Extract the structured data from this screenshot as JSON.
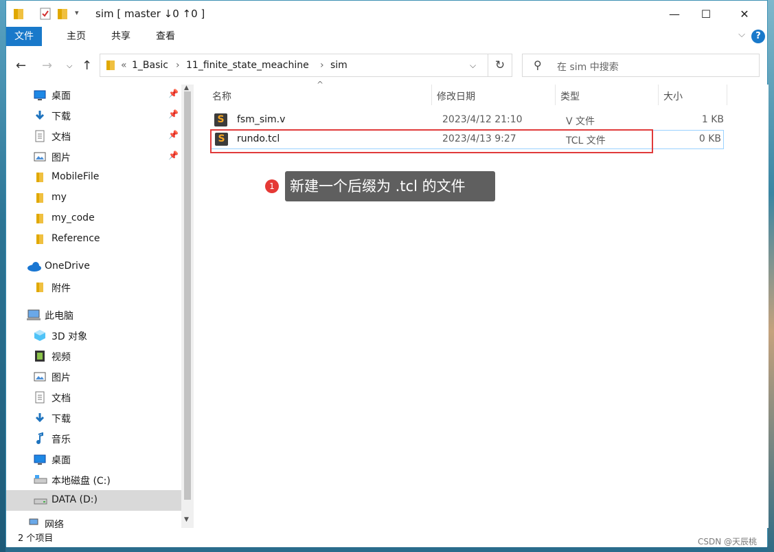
{
  "window": {
    "title": "sim [ master ↓0 ↑0 ]",
    "minimize": "—",
    "maximize": "☐",
    "close": "✕"
  },
  "ribbon": {
    "tabs": [
      "文件",
      "主页",
      "共享",
      "查看"
    ],
    "help": "?"
  },
  "address": {
    "overflow": "«",
    "parts": [
      "1_Basic",
      "11_finite_state_meachine",
      "sim"
    ],
    "separator": "›"
  },
  "search": {
    "placeholder": "在 sim 中搜索"
  },
  "sidebar": {
    "items": [
      {
        "label": "桌面",
        "icon": "desktop-icon",
        "pinned": true
      },
      {
        "label": "下载",
        "icon": "download-icon",
        "pinned": true
      },
      {
        "label": "文档",
        "icon": "document-icon",
        "pinned": true
      },
      {
        "label": "图片",
        "icon": "picture-icon",
        "pinned": true
      },
      {
        "label": "MobileFile",
        "icon": "folder-icon"
      },
      {
        "label": "my",
        "icon": "folder-icon"
      },
      {
        "label": "my_code",
        "icon": "folder-icon"
      },
      {
        "label": "Reference",
        "icon": "folder-icon"
      },
      {
        "label": "OneDrive",
        "icon": "cloud-icon"
      },
      {
        "label": "附件",
        "icon": "folder-icon"
      },
      {
        "label": "此电脑",
        "icon": "computer-icon"
      },
      {
        "label": "3D 对象",
        "icon": "cube-icon"
      },
      {
        "label": "视频",
        "icon": "video-icon"
      },
      {
        "label": "图片",
        "icon": "picture-icon"
      },
      {
        "label": "文档",
        "icon": "document-icon"
      },
      {
        "label": "下载",
        "icon": "download-icon"
      },
      {
        "label": "音乐",
        "icon": "music-icon"
      },
      {
        "label": "桌面",
        "icon": "desktop-icon"
      },
      {
        "label": "本地磁盘 (C:)",
        "icon": "drive-c-icon"
      },
      {
        "label": "DATA (D:)",
        "icon": "drive-icon"
      },
      {
        "label": "网络",
        "icon": "network-icon"
      }
    ]
  },
  "list": {
    "columns": [
      "名称",
      "修改日期",
      "类型",
      "大小"
    ],
    "rows": [
      {
        "name": "fsm_sim.v",
        "date": "2023/4/12 21:10",
        "type": "V 文件",
        "size": "1 KB"
      },
      {
        "name": "rundo.tcl",
        "date": "2023/4/13 9:27",
        "type": "TCL 文件",
        "size": "0 KB"
      }
    ]
  },
  "annotation": {
    "number": "1",
    "text": "新建一个后缀为 .tcl 的文件"
  },
  "status": {
    "count": "2 个项目"
  },
  "watermark": "CSDN @天辰桃",
  "colors": {
    "accent": "#1979ca",
    "highlight": "#e03a3a",
    "selection": "#cce8ff"
  }
}
